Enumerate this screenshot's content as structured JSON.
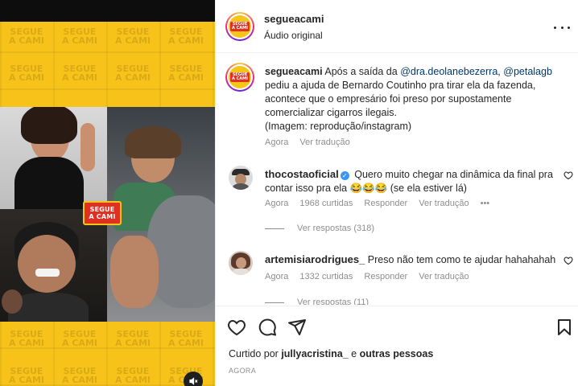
{
  "post": {
    "username": "segueacami",
    "audio_label": "Áudio original",
    "logo_text": [
      "SEGUE",
      "A CAMI"
    ]
  },
  "caption": {
    "username": "segueacami",
    "text_1": " Após a saída da ",
    "mention_1": "@dra.deolanebezerra",
    "text_2": ", ",
    "mention_2": "@petalagb",
    "text_3": " pediu a ajuda de Bernardo Coutinho pra tirar ela da fazenda, acontece que o empresário foi preso por supostamente comercializar cigarros ilegais.",
    "text_4": "(Imagem: reprodução/instagram)",
    "time": "Agora",
    "translate": "Ver tradução"
  },
  "comments": [
    {
      "username": "thocostaoficial",
      "verified": true,
      "text": " Quero muito chegar na dinâmica da final pra contar isso pra ela 😂😂😂 (se ela estiver lá)",
      "time": "Agora",
      "likes": "1968 curtidas",
      "reply": "Responder",
      "translate": "Ver tradução",
      "more": "•••",
      "view_replies": "Ver respostas (318)"
    },
    {
      "username": "artemisiarodrigues_",
      "verified": false,
      "text": " Preso não tem como te ajudar hahahahah",
      "time": "Agora",
      "likes": "1332 curtidas",
      "reply": "Responder",
      "translate": "Ver tradução",
      "view_replies": "Ver respostas (11)"
    }
  ],
  "footer": {
    "liked_by_prefix": "Curtido por ",
    "liked_by_user": "jullyacristina_",
    "liked_by_suffix": " e ",
    "liked_by_others": "outras pessoas",
    "time_ago": "AGORA"
  },
  "icons": {
    "like": "heart-icon",
    "comment": "comment-icon",
    "share": "send-icon",
    "save": "bookmark-icon",
    "more": "more-options-icon",
    "mute": "volume-muted-icon"
  },
  "colors": {
    "brand_yellow": "#f7c21a",
    "brand_red": "#e03021",
    "mention": "#00376b",
    "verified": "#3897f0",
    "muted_text": "#8e8e8e"
  }
}
